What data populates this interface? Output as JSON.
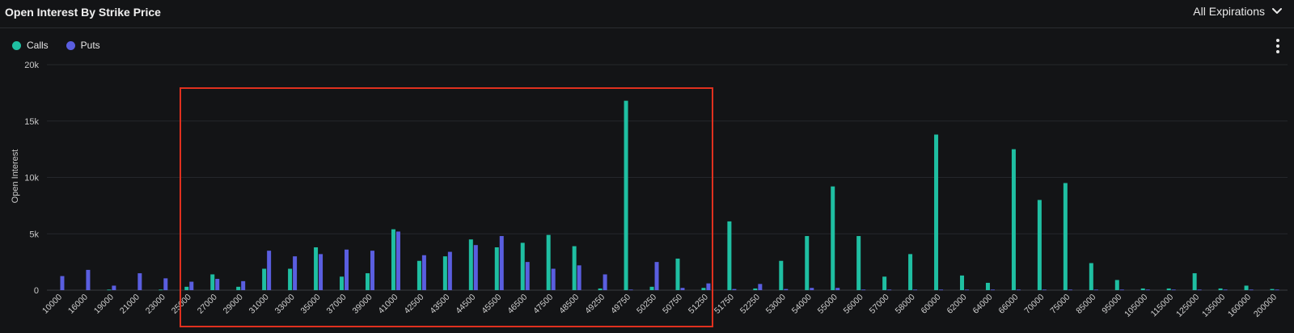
{
  "header": {
    "title": "Open Interest By Strike Price",
    "expiration_label": "All Expirations"
  },
  "legend": {
    "calls_label": "Calls",
    "puts_label": "Puts"
  },
  "colors": {
    "calls": "#1fbfa2",
    "puts": "#5a5ee0",
    "highlight": "#e0301e",
    "grid": "#25272b",
    "background": "#131416"
  },
  "icons": {
    "expiration_icon": "chevron-down-icon",
    "menu_icon": "kebab-menu-icon"
  },
  "chart_data": {
    "type": "bar",
    "title": "Open Interest By Strike Price",
    "xlabel": "",
    "ylabel": "Open Interest",
    "ylim": [
      0,
      20000
    ],
    "y_ticks": [
      0,
      5000,
      10000,
      15000,
      20000
    ],
    "y_tick_labels": [
      "0",
      "5k",
      "10k",
      "15k",
      "20k"
    ],
    "grid": true,
    "legend_position": "top-left",
    "categories": [
      "10000",
      "16000",
      "19000",
      "21000",
      "23000",
      "25000",
      "27000",
      "29000",
      "31000",
      "33000",
      "35000",
      "37000",
      "39000",
      "41000",
      "42500",
      "43500",
      "44500",
      "45500",
      "46500",
      "47500",
      "48500",
      "49250",
      "49750",
      "50250",
      "50750",
      "51250",
      "51750",
      "52250",
      "53000",
      "54000",
      "55000",
      "56000",
      "57000",
      "58000",
      "60000",
      "62000",
      "64000",
      "66000",
      "70000",
      "75000",
      "85000",
      "95000",
      "105000",
      "115000",
      "125000",
      "135000",
      "160000",
      "200000"
    ],
    "series": [
      {
        "name": "Calls",
        "values": [
          0,
          0,
          50,
          0,
          50,
          300,
          1400,
          300,
          1900,
          1900,
          3800,
          1200,
          1500,
          5400,
          2600,
          3000,
          4500,
          3800,
          4200,
          4900,
          3900,
          150,
          16800,
          300,
          2800,
          200,
          6100,
          150,
          2600,
          4800,
          9200,
          4800,
          1200,
          3200,
          13800,
          1300,
          650,
          12500,
          8000,
          9500,
          2400,
          900,
          150,
          150,
          1500,
          150,
          400,
          100
        ]
      },
      {
        "name": "Puts",
        "values": [
          1250,
          1800,
          400,
          1500,
          1050,
          750,
          1000,
          800,
          3500,
          3000,
          3200,
          3600,
          3500,
          5200,
          3100,
          3400,
          4000,
          4800,
          2500,
          1900,
          2200,
          1400,
          50,
          2500,
          200,
          600,
          100,
          550,
          100,
          200,
          200,
          50,
          50,
          50,
          50,
          50,
          50,
          50,
          50,
          50,
          50,
          50,
          50,
          50,
          50,
          50,
          50,
          50
        ]
      }
    ]
  }
}
